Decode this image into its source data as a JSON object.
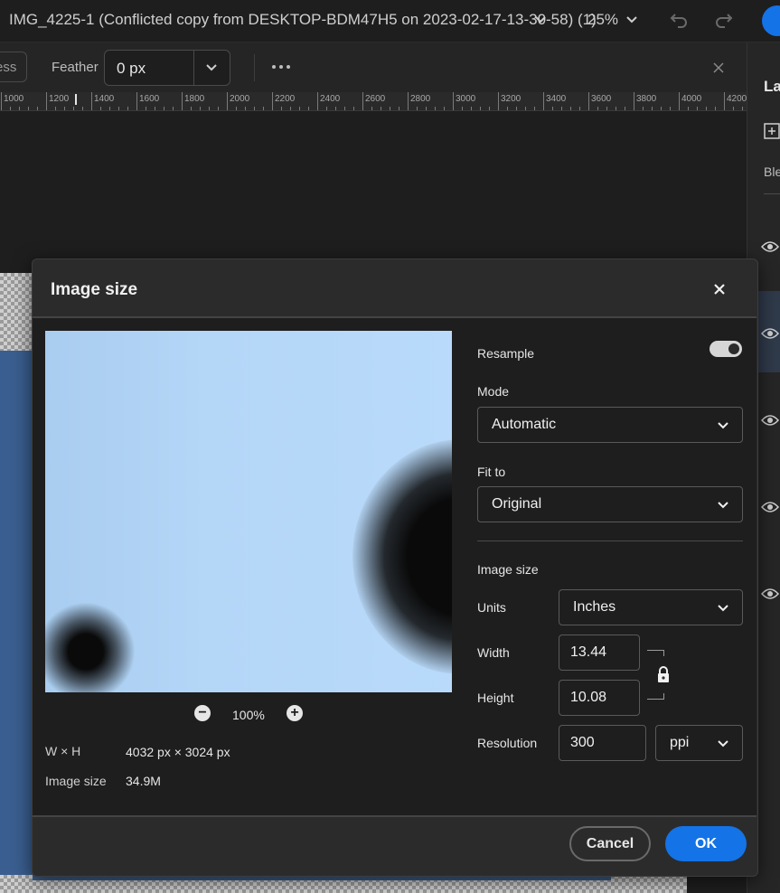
{
  "app": {
    "document_title": "IMG_4225-1 (Conflicted copy from DESKTOP-BDM47H5 on 2023-02-17-13-30-58) (1)",
    "zoom": "25%"
  },
  "options_bar": {
    "left_button_partial": "ess",
    "feather_label": "Feather",
    "feather_value": "0 px"
  },
  "ruler": {
    "labels": [
      "1000",
      "1200",
      "1400",
      "1600",
      "1800",
      "2000",
      "2200",
      "2400",
      "2600",
      "2800",
      "3000",
      "3200",
      "3400",
      "3600",
      "3800",
      "4000",
      "4200"
    ]
  },
  "right_panel": {
    "title_partial": "La",
    "blend_partial": "Ble"
  },
  "dialog": {
    "title": "Image size",
    "preview_zoom": "100%",
    "info": {
      "wh_label": "W × H",
      "wh_value": "4032 px × 3024 px",
      "size_label": "Image size",
      "size_value": "34.9M"
    },
    "resample_label": "Resample",
    "resample_on": true,
    "mode_label": "Mode",
    "mode_value": "Automatic",
    "fit_label": "Fit to",
    "fit_value": "Original",
    "section_label": "Image size",
    "units_label": "Units",
    "units_value": "Inches",
    "width_label": "Width",
    "width_value": "13.44",
    "height_label": "Height",
    "height_value": "10.08",
    "resolution_label": "Resolution",
    "resolution_value": "300",
    "resolution_unit": "ppi",
    "cancel_label": "Cancel",
    "ok_label": "OK"
  },
  "colors": {
    "accent": "#1473e6",
    "background": "#1e1e1e",
    "dialog": "#2b2b2b"
  }
}
